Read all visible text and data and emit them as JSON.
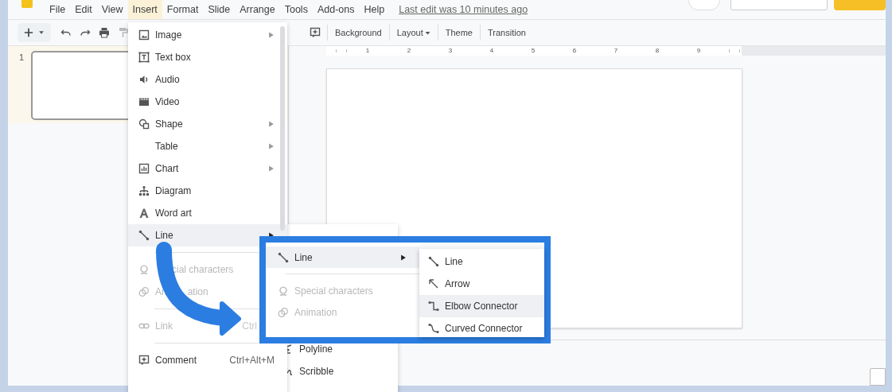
{
  "menu_bar": {
    "items": [
      {
        "label": "File",
        "selected": false
      },
      {
        "label": "Edit",
        "selected": false
      },
      {
        "label": "View",
        "selected": false
      },
      {
        "label": "Insert",
        "selected": true
      },
      {
        "label": "Format",
        "selected": false
      },
      {
        "label": "Slide",
        "selected": false
      },
      {
        "label": "Arrange",
        "selected": false
      },
      {
        "label": "Tools",
        "selected": false
      },
      {
        "label": "Add-ons",
        "selected": false
      },
      {
        "label": "Help",
        "selected": false
      }
    ],
    "last_edit": "Last edit was 10 minutes ago"
  },
  "toolbar": {
    "buttons": [
      {
        "label": "Background",
        "kind": "button"
      },
      {
        "label": "Layout",
        "kind": "dropdown"
      },
      {
        "label": "Theme",
        "kind": "button"
      },
      {
        "label": "Transition",
        "kind": "button"
      }
    ]
  },
  "filmstrip": {
    "slides": [
      {
        "number": "1",
        "selected": true
      }
    ]
  },
  "ruler": {
    "labels": [
      "1",
      "2",
      "3",
      "4",
      "5",
      "6",
      "7",
      "8",
      "9"
    ]
  },
  "insert_menu": {
    "items": [
      {
        "kind": "item",
        "label": "Image",
        "submenu": true,
        "disabled": false,
        "highlighted": false
      },
      {
        "kind": "item",
        "label": "Text box",
        "submenu": false,
        "disabled": false,
        "highlighted": false
      },
      {
        "kind": "item",
        "label": "Audio",
        "submenu": false,
        "disabled": false,
        "highlighted": false
      },
      {
        "kind": "item",
        "label": "Video",
        "submenu": false,
        "disabled": false,
        "highlighted": false
      },
      {
        "kind": "item",
        "label": "Shape",
        "submenu": true,
        "disabled": false,
        "highlighted": false
      },
      {
        "kind": "item",
        "label": "Table",
        "submenu": true,
        "disabled": false,
        "highlighted": false
      },
      {
        "kind": "item",
        "label": "Chart",
        "submenu": true,
        "disabled": false,
        "highlighted": false
      },
      {
        "kind": "item",
        "label": "Diagram",
        "submenu": false,
        "disabled": false,
        "highlighted": false
      },
      {
        "kind": "item",
        "label": "Word art",
        "submenu": false,
        "disabled": false,
        "highlighted": false
      },
      {
        "kind": "item",
        "label": "Line",
        "submenu": true,
        "disabled": false,
        "highlighted": true
      },
      {
        "kind": "separator"
      },
      {
        "kind": "item",
        "label_parts": [
          "cial characters"
        ],
        "submenu": false,
        "disabled": true,
        "highlighted": false
      },
      {
        "kind": "item",
        "label_parts": [
          "An",
          "ation"
        ],
        "submenu": false,
        "disabled": true,
        "highlighted": false
      },
      {
        "kind": "separator"
      },
      {
        "kind": "item",
        "label": "Link",
        "shortcut": "Ctrl",
        "submenu": false,
        "disabled": true,
        "highlighted": false
      },
      {
        "kind": "separator"
      },
      {
        "kind": "item",
        "label": "Comment",
        "shortcut": "Ctrl+Alt+M",
        "submenu": false,
        "disabled": false,
        "highlighted": false
      }
    ]
  },
  "line_submenu": {
    "items": [
      {
        "label": "Polyline"
      },
      {
        "label": "Scribble"
      }
    ]
  },
  "callout": {
    "menu_items": [
      {
        "kind": "item",
        "label": "Line",
        "submenu": true,
        "disabled": false,
        "highlighted": true
      },
      {
        "kind": "separator"
      },
      {
        "kind": "item",
        "label": "Special characters",
        "submenu": false,
        "disabled": true,
        "highlighted": false
      },
      {
        "kind": "item",
        "label": "Animation",
        "submenu": false,
        "disabled": true,
        "highlighted": false
      }
    ],
    "submenu_items": [
      {
        "label": "Line",
        "highlighted": false
      },
      {
        "label": "Arrow",
        "highlighted": false
      },
      {
        "label": "Elbow Connector",
        "highlighted": true
      },
      {
        "label": "Curved Connector",
        "highlighted": false
      }
    ]
  }
}
